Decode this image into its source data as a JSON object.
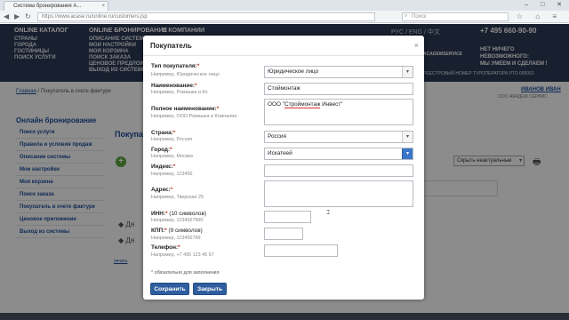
{
  "browser": {
    "tab_title": "Система бронирования А...",
    "url": "https://www.acase.ru/online.ru/customers.jsp",
    "search_placeholder": "Поиск",
    "window_controls": "– □ ✕"
  },
  "header": {
    "columns": [
      {
        "title": "ONLINE КАТАЛОГ",
        "links": [
          "СТРАНЫ",
          "ГОРОДА",
          "ГОСТИНИЦЫ",
          "ПОИСК УСЛУГИ"
        ]
      },
      {
        "title": "ONLINE БРОНИРОВАНИЕ",
        "links": [
          "ОПИСАНИЕ СИСТЕМЫ",
          "МОИ НАСТРОЙКИ",
          "МОЯ КОРЗИНА",
          "ПОИСК ЗАКАЗА",
          "ЦЕНОВОЕ ПРЕДЛОЖЕНИЕ",
          "ВЫХОД ИЗ СИСТЕМЫ"
        ]
      },
      {
        "title": "О КОМПАНИИ",
        "links": []
      }
    ],
    "languages": "РУС / ENG / 中文",
    "phone": "+7 495 660-90-90",
    "slogan": [
      "НЕТ НИЧЕГО",
      "НЕВОЗМОЖНОГО:",
      "МЫ УМЕЕМ И СДЕЛАЕМ !"
    ],
    "logo_text": "ACADEMSERVICE",
    "registry": "РЕЕСТРОВЫЙ НОМЕР ТУРОПЕРАТОРА РТО 000001"
  },
  "breadcrumb": {
    "home": "Главная",
    "current": "/ Покупатель в счете фактуре"
  },
  "user": {
    "name": "ИВАНОВ ИВАН",
    "company": "ООО АКАДЕМ СЕРВИС"
  },
  "sidebar": {
    "title": "Онлайн бронирование",
    "items": [
      "Поиск услуги",
      "Правила и условия продаж",
      "Описание системы",
      "Мои настройки",
      "Моя корзина",
      "Поиск заказа",
      "Покупатель в счете фактуре",
      "Ценовое приложение",
      "Выход из системы"
    ]
  },
  "page": {
    "heading": "Покупа",
    "sort_select": "Скрыть неактуальные",
    "row_prefix": "Дя",
    "print_link": "печать"
  },
  "modal": {
    "title": "Покупатель",
    "close": "×",
    "fields": {
      "type": {
        "label": "Тип покупателя:",
        "hint": "Например, Юридическое лицо",
        "value": "Юридическое лицо"
      },
      "name": {
        "label": "Наименование:",
        "hint": "Например, Ромашка и Ко",
        "value": "Стоймонтаж"
      },
      "full_name": {
        "label": "Полное наименование:",
        "hint": "Например, ООО Ромашка и Компания",
        "value_prefix": "ООО \"",
        "value_underlined": "Строймонтаж",
        "value_suffix": " Инвест\""
      },
      "country": {
        "label": "Страна:",
        "hint": "Например, Россия",
        "value": "Россия"
      },
      "city": {
        "label": "Город:",
        "hint": "Например, Москва",
        "value": "Искатеей"
      },
      "index": {
        "label": "Индекс:",
        "hint": "Например, 123456",
        "value": ""
      },
      "address": {
        "label": "Адрес:",
        "hint": "Например, Тверская 25",
        "value": ""
      },
      "inn": {
        "label": "ИНН:",
        "note": " (10 символов)",
        "hint": "Например, 1234567890",
        "value": ""
      },
      "kpp": {
        "label": "КПП:",
        "note": " (9 символов)",
        "hint": "Например, 123456789",
        "value": ""
      },
      "phone": {
        "label": "Телефон:",
        "hint": "Например, +7 495 123 45 67",
        "value": ""
      }
    },
    "required_star": "*",
    "required_note": "* обязательно для заполнения",
    "buttons": {
      "save": "Сохранить",
      "close": "Закрыть"
    }
  }
}
